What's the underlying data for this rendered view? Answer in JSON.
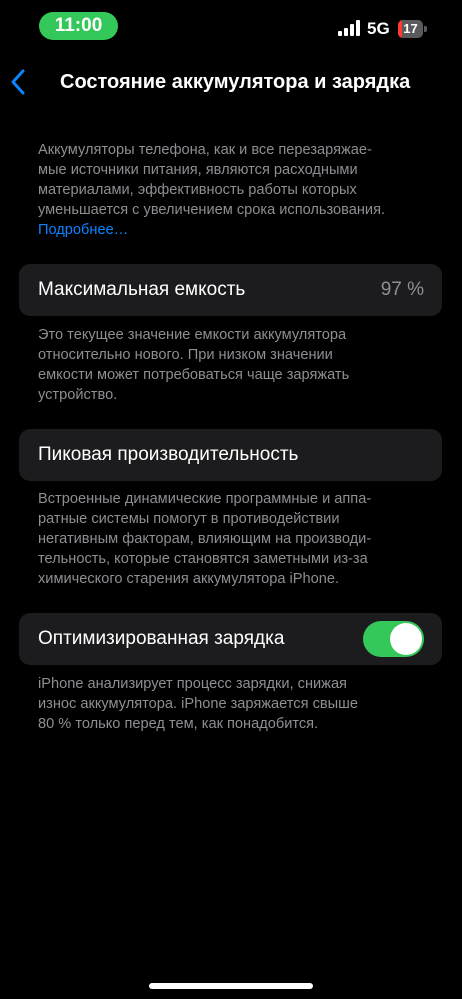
{
  "status_bar": {
    "time": "11:00",
    "time_pill_color": "#34c759",
    "network": "5G",
    "signal_icon": "signal-bars-icon",
    "battery_level": "17",
    "battery_fraction": 0.17,
    "battery_color": "#ff3b30"
  },
  "nav": {
    "back_icon": "chevron-left-icon",
    "title": "Состояние аккумулятора и зарядка"
  },
  "intro": {
    "lines": [
      "Аккумуляторы телефона, как и все перезаряжае-",
      "мые источники питания, являются расходными",
      "материалами, эффективность работы которых",
      "уменьшается с увеличением срока использования."
    ],
    "link": "Подробнее…"
  },
  "max_capacity": {
    "label": "Максимальная емкость",
    "value": "97 %",
    "footer_lines": [
      "Это текущее значение емкости аккумулятора",
      "относительно нового. При низком значении",
      "емкости может потребоваться чаще заряжать",
      "устройство."
    ]
  },
  "peak_performance": {
    "label": "Пиковая производительность",
    "footer_lines": [
      "Встроенные динамические программные и аппа-",
      "ратные системы помогут в противодействии",
      "негативным факторам, влияющим на производи-",
      "тельность, которые становятся заметными из-за",
      "химического старения аккумулятора iPhone."
    ]
  },
  "optimized_charging": {
    "label": "Оптимизированная зарядка",
    "toggle_on": true,
    "toggle_color": "#34c759",
    "footer_lines": [
      "iPhone анализирует процесс зарядки, снижая",
      "износ аккумулятора. iPhone заряжается свыше",
      "80 % только перед тем, как понадобится."
    ]
  },
  "colors": {
    "background": "#000000",
    "cell": "#1c1c1e",
    "secondary_text": "#8e8e93",
    "link": "#0a84ff"
  }
}
